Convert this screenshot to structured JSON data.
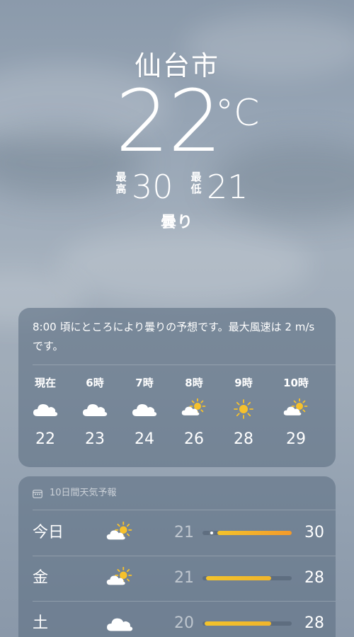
{
  "location": {
    "city": "仙台市",
    "temperature": "22",
    "unit": "°C",
    "high_label": "最高",
    "high": "30",
    "low_label": "最低",
    "low": "21",
    "condition": "曇り"
  },
  "hourly": {
    "summary": "8:00 頃にところにより曇りの予想です。最大風速は 2 m/s です。",
    "hours": [
      {
        "time": "現在",
        "icon": "cloud-icon",
        "temp": "22"
      },
      {
        "time": "6時",
        "icon": "cloud-icon",
        "temp": "23"
      },
      {
        "time": "7時",
        "icon": "cloud-icon",
        "temp": "24"
      },
      {
        "time": "8時",
        "icon": "partly-sunny-icon",
        "temp": "26"
      },
      {
        "time": "9時",
        "icon": "sun-icon",
        "temp": "28"
      },
      {
        "time": "10時",
        "icon": "partly-sunny-icon",
        "temp": "29"
      }
    ]
  },
  "daily": {
    "title": "10日間天気予報",
    "days": [
      {
        "day": "今日",
        "icon": "partly-sunny-icon",
        "low": "21",
        "high": "30",
        "range_start": 0.17,
        "range_end": 1.0,
        "current": 0.1
      },
      {
        "day": "金",
        "icon": "partly-sunny-icon",
        "low": "21",
        "high": "28",
        "range_start": 0.04,
        "range_end": 0.77
      },
      {
        "day": "土",
        "icon": "cloud-icon",
        "low": "20",
        "high": "28",
        "range_start": 0.02,
        "range_end": 0.77
      }
    ]
  },
  "colors": {
    "card": "#60718a",
    "bar_orange": "#f39a2b",
    "bar_yellow": "#f3c32b",
    "sun": "#f6c12c"
  }
}
